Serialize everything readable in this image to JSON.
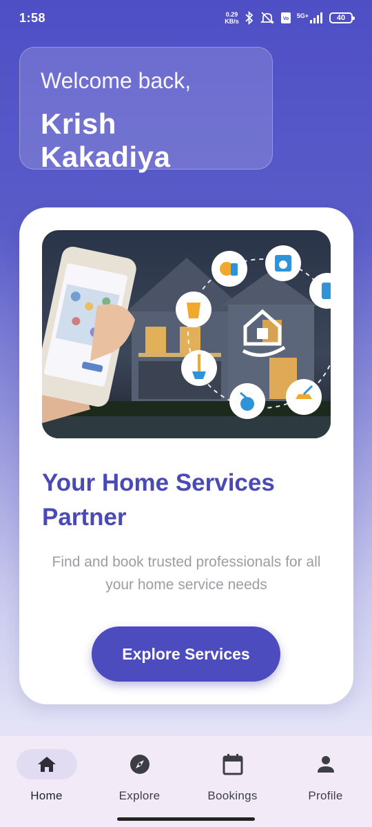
{
  "status_bar": {
    "time": "1:58",
    "net_speed_value": "0.29",
    "net_speed_unit": "KB/s",
    "network": "5G+",
    "battery": "40"
  },
  "welcome": {
    "greeting": "Welcome back,",
    "name": "Krish Kakadiya"
  },
  "hero_card": {
    "title": "Your Home Services Partner",
    "description": "Find and book trusted professionals for all your home service needs",
    "button_label": "Explore Services"
  },
  "bottom_nav": {
    "items": [
      {
        "label": "Home",
        "icon": "home-icon",
        "active": true
      },
      {
        "label": "Explore",
        "icon": "compass-icon",
        "active": false
      },
      {
        "label": "Bookings",
        "icon": "calendar-icon",
        "active": false
      },
      {
        "label": "Profile",
        "icon": "person-icon",
        "active": false
      }
    ]
  },
  "colors": {
    "primary": "#4c4cbf",
    "title": "#4a4ab6",
    "nav_background": "#f2ebf7",
    "nav_active_pill": "#e2dcf3"
  }
}
